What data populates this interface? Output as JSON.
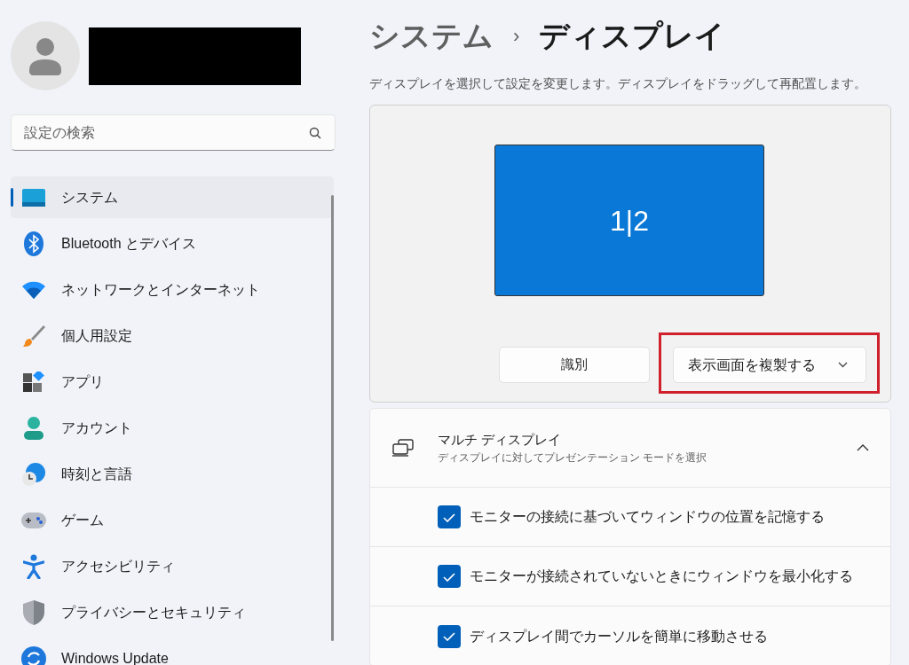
{
  "account": {
    "redacted": true
  },
  "search": {
    "placeholder": "設定の検索"
  },
  "sidebar": {
    "items": [
      {
        "label": "システム",
        "selected": true
      },
      {
        "label": "Bluetooth とデバイス",
        "selected": false
      },
      {
        "label": "ネットワークとインターネット",
        "selected": false
      },
      {
        "label": "個人用設定",
        "selected": false
      },
      {
        "label": "アプリ",
        "selected": false
      },
      {
        "label": "アカウント",
        "selected": false
      },
      {
        "label": "時刻と言語",
        "selected": false
      },
      {
        "label": "ゲーム",
        "selected": false
      },
      {
        "label": "アクセシビリティ",
        "selected": false
      },
      {
        "label": "プライバシーとセキュリティ",
        "selected": false
      },
      {
        "label": "Windows Update",
        "selected": false
      }
    ]
  },
  "breadcrumb": {
    "parent": "システム",
    "separator": "›",
    "current": "ディスプレイ"
  },
  "description": "ディスプレイを選択して設定を変更します。ディスプレイをドラッグして再配置します。",
  "arrangement": {
    "monitor_label": "1|2",
    "identify_button": "識別",
    "mode_dropdown": {
      "value": "表示画面を複製する",
      "highlighted": true
    }
  },
  "multi_display": {
    "title": "マルチ ディスプレイ",
    "subtitle": "ディスプレイに対してプレゼンテーション モードを選択",
    "expanded": true,
    "options": [
      {
        "label": "モニターの接続に基づいてウィンドウの位置を記憶する",
        "checked": true
      },
      {
        "label": "モニターが接続されていないときにウィンドウを最小化する",
        "checked": true
      },
      {
        "label": "ディスプレイ間でカーソルを簡単に移動させる",
        "checked": true
      }
    ]
  }
}
